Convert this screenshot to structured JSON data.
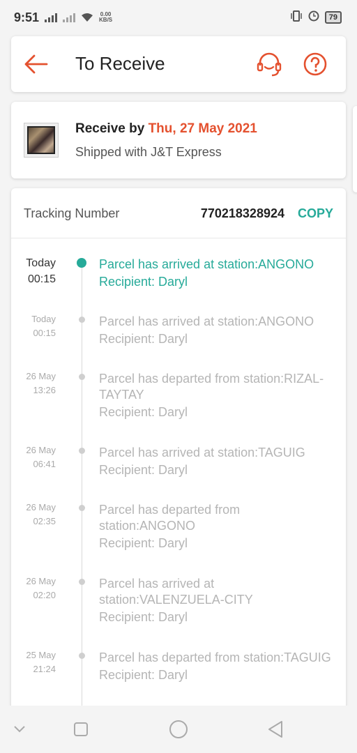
{
  "status_bar": {
    "time": "9:51",
    "net_speed_value": "0.00",
    "net_speed_unit": "KB/S",
    "battery": "79"
  },
  "header": {
    "title": "To Receive"
  },
  "delivery": {
    "receive_by_label": "Receive by",
    "receive_date": "Thu, 27 May 2021",
    "shipped_with": "Shipped with J&T Express"
  },
  "tracking": {
    "label": "Tracking Number",
    "number": "770218328924",
    "copy_label": "COPY",
    "events": [
      {
        "date": "Today",
        "time": "00:15",
        "desc": "Parcel has arrived at station:ANGONO",
        "recipient": "Recipient: Daryl",
        "active": true
      },
      {
        "date": "Today",
        "time": "00:15",
        "desc": "Parcel has arrived at station:ANGONO",
        "recipient": "Recipient: Daryl",
        "active": false
      },
      {
        "date": "26 May",
        "time": "13:26",
        "desc": "Parcel has departed from station:RIZAL-TAYTAY",
        "recipient": "Recipient: Daryl",
        "active": false
      },
      {
        "date": "26 May",
        "time": "06:41",
        "desc": "Parcel has arrived at station:TAGUIG",
        "recipient": "Recipient: Daryl",
        "active": false
      },
      {
        "date": "26 May",
        "time": "02:35",
        "desc": "Parcel has departed from station:ANGONO",
        "recipient": "Recipient: Daryl",
        "active": false
      },
      {
        "date": "26 May",
        "time": "02:20",
        "desc": "Parcel has arrived at station:VALENZUELA-CITY",
        "recipient": "Recipient: Daryl",
        "active": false
      },
      {
        "date": "25 May",
        "time": "21:24",
        "desc": "Parcel has departed from station:TAGUIG",
        "recipient": "Recipient: Daryl",
        "active": false
      }
    ]
  },
  "colors": {
    "accent": "#e4512f",
    "teal": "#26aa99"
  },
  "icons": {
    "back": "arrow-left-icon",
    "support": "headset-icon",
    "help": "question-circle-icon"
  }
}
